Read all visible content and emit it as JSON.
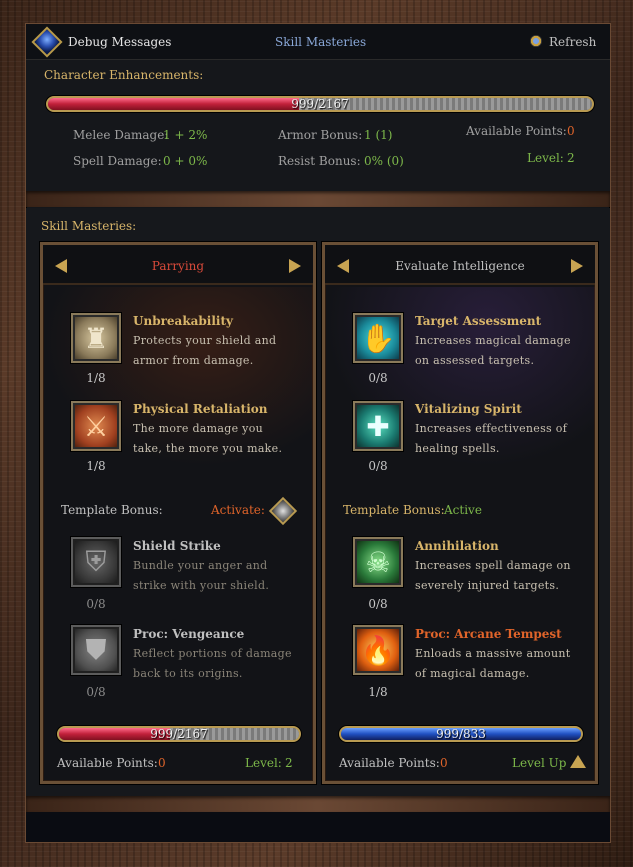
{
  "header": {
    "debug_label": "Debug Messages",
    "title": "Skill Masteries",
    "refresh_label": "Refresh"
  },
  "character": {
    "section_label": "Character Enhancements:",
    "xp_text": "999/2167",
    "xp_fraction": 0.461,
    "melee_label": "Melee Damage:",
    "melee_value": "1 + 2%",
    "spell_label": "Spell Damage:",
    "spell_value": "0 + 0%",
    "armor_label": "Armor Bonus:",
    "armor_value": "1 (1)",
    "resist_label": "Resist Bonus:",
    "resist_value": "0% (0)",
    "points_label": "Available Points:",
    "points_value": "0",
    "level_label": "Level:",
    "level_value": "2"
  },
  "masteries": {
    "section_label": "Skill Masteries:",
    "left": {
      "title": "Parrying",
      "skills": [
        {
          "name": "Unbreakability",
          "desc": "Protects your shield and armor from damage.",
          "rank": "1/8",
          "icon": "knight-armor-icon"
        },
        {
          "name": "Physical Retaliation",
          "desc": "The more damage you take, the more you make.",
          "rank": "1/8",
          "icon": "retaliation-icon"
        }
      ],
      "template_label": "Template Bonus:",
      "template_status": "Activate:",
      "template_skills": [
        {
          "name": "Shield Strike",
          "desc": "Bundle your anger and strike with your shield.",
          "rank": "0/8",
          "icon": "shield-strike-icon"
        },
        {
          "name": "Proc: Vengeance",
          "desc": "Reflect portions of damage back to its origins.",
          "rank": "0/8",
          "icon": "vengeance-shield-icon"
        }
      ],
      "xp_text": "999/2167",
      "xp_fraction": 0.461,
      "points_label": "Available Points:",
      "points_value": "0",
      "level_label": "Level:",
      "level_value": "2"
    },
    "right": {
      "title": "Evaluate Intelligence",
      "skills": [
        {
          "name": "Target Assessment",
          "desc": "Increases magical damage on assessed targets.",
          "rank": "0/8",
          "icon": "open-hand-icon"
        },
        {
          "name": "Vitalizing Spirit",
          "desc": "Increases effectiveness of healing spells.",
          "rank": "0/8",
          "icon": "healing-cross-icon"
        }
      ],
      "template_label": "Template Bonus:",
      "template_status": "Active",
      "template_skills": [
        {
          "name": "Annihilation",
          "desc": "Increases spell damage on severely injured targets.",
          "rank": "0/8",
          "icon": "skull-icon"
        },
        {
          "name": "Proc: Arcane Tempest",
          "desc": "Enloads a massive amount of magical damage.",
          "rank": "1/8",
          "icon": "arcane-fire-icon"
        }
      ],
      "xp_text": "999/833",
      "xp_fraction": 1.0,
      "points_label": "Available Points:",
      "points_value": "0",
      "levelup_label": "Level Up"
    }
  },
  "colors": {
    "gold": "#d8b56a",
    "green": "#7db84a",
    "orange": "#e0642a",
    "title_blue": "#8aa8d8"
  }
}
